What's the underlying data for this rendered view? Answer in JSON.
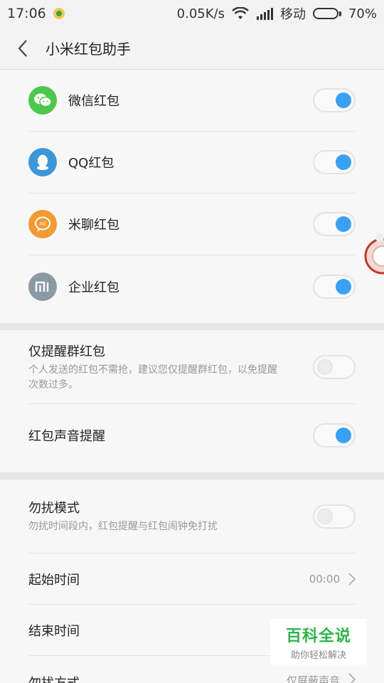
{
  "status_bar": {
    "time": "17:06",
    "speed": "0.05K/s",
    "carrier": "移动",
    "battery_percent": "70%",
    "battery_level": 0.7
  },
  "header": {
    "title": "小米红包助手"
  },
  "red_packets": [
    {
      "label": "微信红包",
      "icon": "wechat-icon",
      "color": "#4cc84c",
      "enabled": true
    },
    {
      "label": "QQ红包",
      "icon": "qq-icon",
      "color": "#3d96d8",
      "enabled": true
    },
    {
      "label": "米聊红包",
      "icon": "miliao-icon",
      "color": "#f39a33",
      "enabled": true
    },
    {
      "label": "企业红包",
      "icon": "mi-icon",
      "color": "#8a9aa3",
      "enabled": true
    }
  ],
  "group_settings": {
    "group_only": {
      "label": "仅提醒群红包",
      "desc": "个人发送的红包不需抢，建议您仅提醒群红包，以免提醒次数过多。",
      "enabled": false
    },
    "sound": {
      "label": "红包声音提醒",
      "enabled": true
    }
  },
  "dnd": {
    "mode": {
      "label": "勿扰模式",
      "desc": "勿扰时间段内，红包提醒与红包闹钟免打扰",
      "enabled": false
    },
    "start": {
      "label": "起始时间",
      "value": "00:00"
    },
    "end": {
      "label": "结束时间",
      "value": ""
    },
    "method": {
      "label": "勿扰方式",
      "value": "仅屏蔽声音"
    }
  },
  "watermark": {
    "title": "百科全说",
    "subtitle": "助你轻松解决"
  },
  "colors": {
    "accent": "#3aa0f3",
    "watermark_green": "#2db44a"
  }
}
